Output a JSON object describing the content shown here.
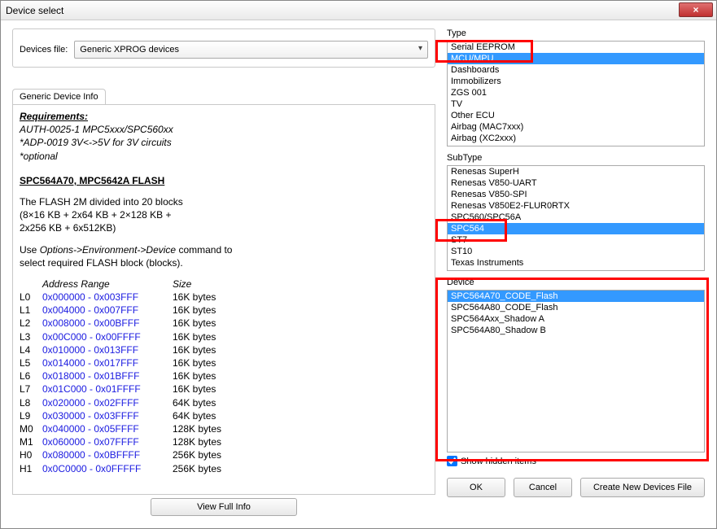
{
  "window": {
    "title": "Device select",
    "close_glyph": "×"
  },
  "left": {
    "devices_file_label": "Devices file:",
    "devices_file_value": "Generic XPROG devices",
    "tab_label": "Generic Device Info",
    "info": {
      "req_title": "Requirements:",
      "req_line1": "AUTH-0025-1 MPC5xxx/SPC560xx",
      "req_line2": "*ADP-0019 3V<->5V for 3V circuits",
      "req_line3": "*optional",
      "flash_title": "SPC564A70, MPC5642A FLASH",
      "body_line1": "The FLASH 2M divided into 20 blocks",
      "body_line2": "(8×16 KB + 2x64 KB +  2×128 KB +",
      "body_line3": "2x256 KB + 6x512KB)",
      "body_line4_a": "Use ",
      "body_line4_b": "Options->Environment->Device",
      "body_line4_c": " command to",
      "body_line5": "select required FLASH block (blocks).",
      "col_addr": "Address Range",
      "col_size": "Size",
      "rows": [
        {
          "lbl": "L0",
          "addr": "0x000000 - 0x003FFF",
          "size": "16K bytes"
        },
        {
          "lbl": "L1",
          "addr": "0x004000 - 0x007FFF",
          "size": "16K bytes"
        },
        {
          "lbl": "L2",
          "addr": "0x008000 - 0x00BFFF",
          "size": "16K bytes"
        },
        {
          "lbl": "L3",
          "addr": "0x00C000 - 0x00FFFF",
          "size": "16K bytes"
        },
        {
          "lbl": "L4",
          "addr": "0x010000 - 0x013FFF",
          "size": "16K bytes"
        },
        {
          "lbl": "L5",
          "addr": "0x014000 - 0x017FFF",
          "size": "16K bytes"
        },
        {
          "lbl": "L6",
          "addr": "0x018000 - 0x01BFFF",
          "size": "16K bytes"
        },
        {
          "lbl": "L7",
          "addr": "0x01C000 - 0x01FFFF",
          "size": "16K bytes"
        },
        {
          "lbl": "L8",
          "addr": "0x020000 - 0x02FFFF",
          "size": "64K bytes"
        },
        {
          "lbl": "L9",
          "addr": "0x030000 - 0x03FFFF",
          "size": "64K bytes"
        },
        {
          "lbl": "M0",
          "addr": "0x040000 - 0x05FFFF",
          "size": "128K bytes"
        },
        {
          "lbl": "M1",
          "addr": "0x060000 - 0x07FFFF",
          "size": "128K bytes"
        },
        {
          "lbl": "H0",
          "addr": "0x080000 - 0x0BFFFF",
          "size": "256K bytes"
        },
        {
          "lbl": "H1",
          "addr": "0x0C0000 - 0x0FFFFF",
          "size": "256K bytes"
        }
      ]
    },
    "view_full_label": "View Full Info"
  },
  "right": {
    "type_label": "Type",
    "type_items": [
      "Serial EEPROM",
      "MCU/MPU",
      "Dashboards",
      "Immobilizers",
      "ZGS 001",
      "TV",
      "Other ECU",
      "Airbag (MAC7xxx)",
      "Airbag (XC2xxx)"
    ],
    "type_selected_index": 1,
    "subtype_label": "SubType",
    "subtype_items": [
      "Renesas SuperH",
      "Renesas V850-UART",
      "Renesas V850-SPI",
      "Renesas V850E2-FLUR0RTX",
      "SPC560/SPC56A",
      "SPC564",
      "ST7",
      "ST10",
      "Texas Instruments"
    ],
    "subtype_selected_index": 5,
    "device_label": "Device",
    "device_items": [
      "SPC564A70_CODE_Flash",
      "SPC564A80_CODE_Flash",
      "SPC564Axx_Shadow A",
      "SPC564A80_Shadow B"
    ],
    "device_selected_index": 0,
    "show_hidden_label": "Show hidden items",
    "ok_label": "OK",
    "cancel_label": "Cancel",
    "create_label": "Create New Devices File"
  }
}
